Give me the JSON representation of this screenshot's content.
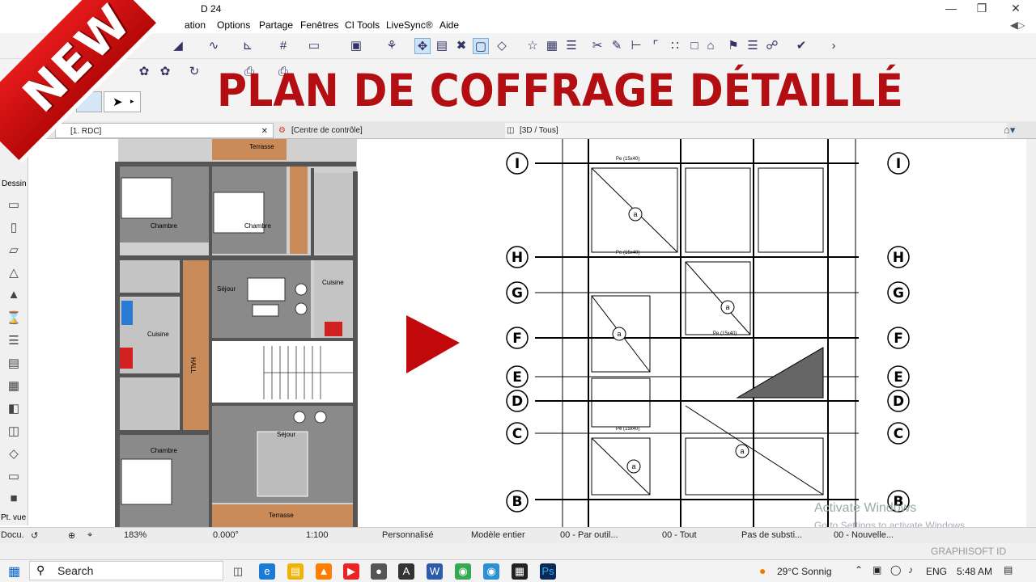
{
  "window": {
    "title_suffix": "D 24"
  },
  "menu": [
    "ation",
    "Options",
    "Partage",
    "Fenêtres",
    "CI Tools",
    "LiveSync®",
    "Aide"
  ],
  "banner": {
    "new_label": "NEW",
    "title": "PLAN DE COFFRAGE DÉTAILLÉ"
  },
  "tabs": [
    {
      "label": "[1. RDC]"
    },
    {
      "label": "[Centre de contrôle]"
    },
    {
      "label": "[3D / Tous]"
    }
  ],
  "toolbox": {
    "label": "Dessin",
    "bottom_label1": "Pt. vue",
    "bottom_label2": "Docu."
  },
  "plan": {
    "rooms": [
      "Terrasse",
      "Chambre",
      "Chambre",
      "Séjour",
      "Cuisine",
      "Cuisine",
      "HALL",
      "Séjour",
      "Chambre",
      "Terrasse"
    ]
  },
  "structure": {
    "grid_labels_rows": [
      "I",
      "H",
      "G",
      "F",
      "E",
      "D",
      "C",
      "B"
    ],
    "beam_label": "Pe (15x40)",
    "slab_label": "a"
  },
  "status": {
    "zoom": "183%",
    "angle": "0.000°",
    "scale": "1:100",
    "pen": "Personnalisé",
    "model": "Modèle entier",
    "layer": "00 - Par outil...",
    "layers2": "00 - Tout",
    "subst": "Pas de substi...",
    "new": "00 - Nouvelle..."
  },
  "activation": {
    "title": "Activate Windows",
    "subtitle": "Go to Settings to activate Windows."
  },
  "graphisoft": "GRAPHISOFT ID",
  "taskbar": {
    "search_placeholder": "Search",
    "weather": "29°C  Sonnig",
    "lang": "ENG",
    "time": "5:48 AM"
  },
  "colors": {
    "accent": "#b30f12",
    "wood": "#c98b5a",
    "wall": "#7a7a7a",
    "floor": "#c8c8c8"
  }
}
